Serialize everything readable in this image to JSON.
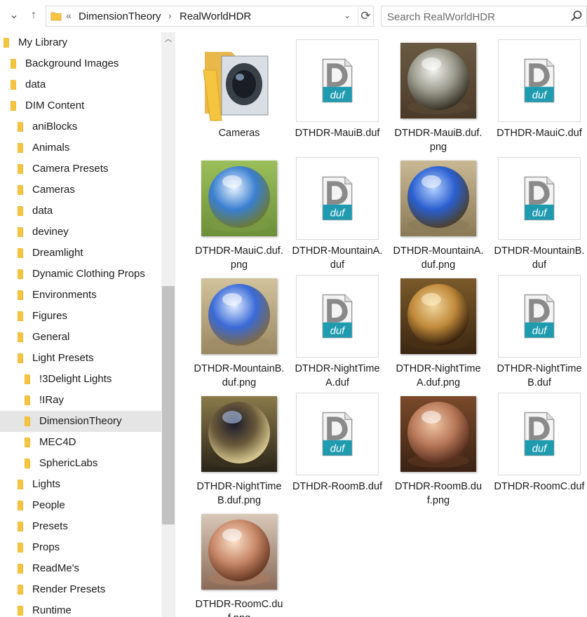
{
  "address_bar": {
    "back_icon": "chevron-down-icon",
    "crumb_overflow": "«",
    "crumbs": [
      "DimensionTheory",
      "RealWorldHDR"
    ],
    "separator": "›"
  },
  "search": {
    "placeholder": "Search RealWorldHDR",
    "value": ""
  },
  "sidebar": {
    "items": [
      {
        "label": "My Library",
        "level": 0
      },
      {
        "label": "Background Images",
        "level": 1
      },
      {
        "label": "data",
        "level": 1
      },
      {
        "label": "DIM Content",
        "level": 1
      },
      {
        "label": "aniBlocks",
        "level": 2
      },
      {
        "label": "Animals",
        "level": 2
      },
      {
        "label": "Camera Presets",
        "level": 2
      },
      {
        "label": "Cameras",
        "level": 2
      },
      {
        "label": "data",
        "level": 2
      },
      {
        "label": "deviney",
        "level": 2
      },
      {
        "label": "Dreamlight",
        "level": 2
      },
      {
        "label": "Dynamic Clothing Props",
        "level": 2
      },
      {
        "label": "Environments",
        "level": 2
      },
      {
        "label": "Figures",
        "level": 2
      },
      {
        "label": "General",
        "level": 2
      },
      {
        "label": "Light Presets",
        "level": 2
      },
      {
        "label": "!3Delight Lights",
        "level": 3
      },
      {
        "label": "!IRay",
        "level": 3
      },
      {
        "label": "DimensionTheory",
        "level": 3,
        "selected": true
      },
      {
        "label": "MEC4D",
        "level": 3
      },
      {
        "label": "SphericLabs",
        "level": 3
      },
      {
        "label": "Lights",
        "level": 2
      },
      {
        "label": "People",
        "level": 2
      },
      {
        "label": "Presets",
        "level": 2
      },
      {
        "label": "Props",
        "level": 2
      },
      {
        "label": "ReadMe's",
        "level": 2
      },
      {
        "label": "Render Presets",
        "level": 2
      },
      {
        "label": "Runtime",
        "level": 2
      }
    ]
  },
  "files": [
    {
      "name": "Cameras",
      "kind": "folder"
    },
    {
      "name": "DTHDR-MauiB.duf",
      "kind": "duf"
    },
    {
      "name": "DTHDR-MauiB.duf.png",
      "kind": "image",
      "scene": "maui-trees"
    },
    {
      "name": "DTHDR-MauiC.duf",
      "kind": "duf"
    },
    {
      "name": "DTHDR-MauiC.duf.png",
      "kind": "image",
      "scene": "grass-sky"
    },
    {
      "name": "DTHDR-MountainA.duf",
      "kind": "duf"
    },
    {
      "name": "DTHDR-MountainA.duf.png",
      "kind": "image",
      "scene": "mountain-a"
    },
    {
      "name": "DTHDR-MountainB.duf",
      "kind": "duf"
    },
    {
      "name": "DTHDR-MountainB.duf.png",
      "kind": "image",
      "scene": "mountain-b"
    },
    {
      "name": "DTHDR-NightTimeA.duf",
      "kind": "duf"
    },
    {
      "name": "DTHDR-NightTimeA.duf.png",
      "kind": "image",
      "scene": "night-a"
    },
    {
      "name": "DTHDR-NightTimeB.duf",
      "kind": "duf"
    },
    {
      "name": "DTHDR-NightTimeB.duf.png",
      "kind": "image",
      "scene": "night-b"
    },
    {
      "name": "DTHDR-RoomB.duf",
      "kind": "duf"
    },
    {
      "name": "DTHDR-RoomB.duf.png",
      "kind": "image",
      "scene": "room-b"
    },
    {
      "name": "DTHDR-RoomC.duf",
      "kind": "duf"
    },
    {
      "name": "DTHDR-RoomC.duf.png",
      "kind": "image",
      "scene": "room-c"
    }
  ],
  "colors": {
    "folder": "#f5c542",
    "duf_teal": "#1f9bb0",
    "selected_bg": "#e5e5e5"
  }
}
